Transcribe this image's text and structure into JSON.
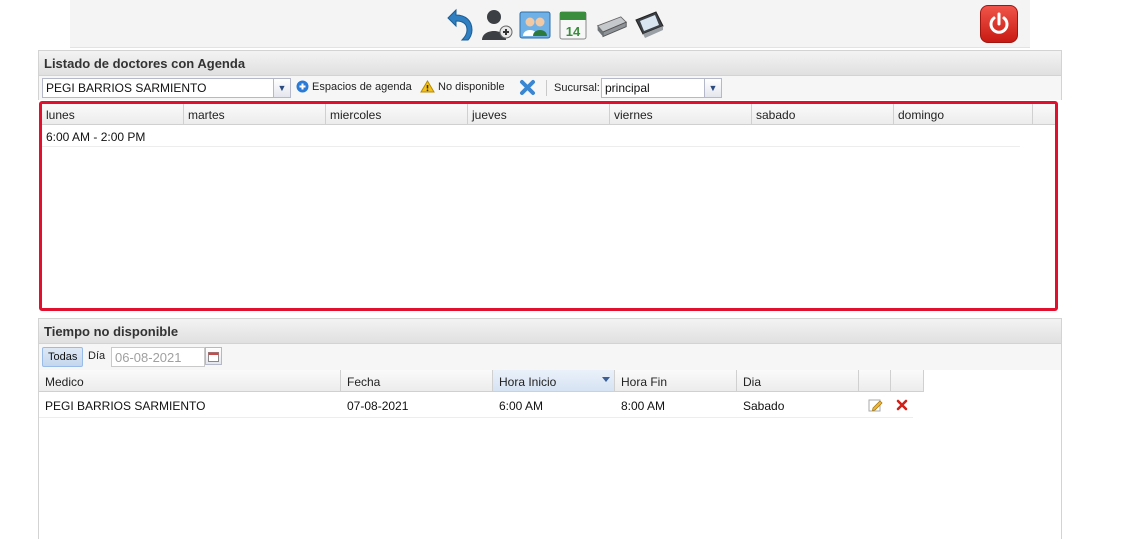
{
  "toolbar": {
    "icons": [
      "back-arrow-icon",
      "add-user-icon",
      "doctors-icon",
      "calendar-icon",
      "printer-icon",
      "monitor-icon"
    ],
    "calendar_day": "14",
    "power_icon": "power-icon"
  },
  "agenda_panel": {
    "title": "Listado de doctores con Agenda",
    "doctor_select": "PEGI BARRIOS SARMIENTO",
    "espacios_label": "Espacios de agenda",
    "no_disponible_label": "No disponible",
    "sucursal_label": "Sucursal:",
    "sucursal_value": "principal",
    "days": [
      "lunes",
      "martes",
      "miercoles",
      "jueves",
      "viernes",
      "sabado",
      "domingo"
    ],
    "schedule_row": "6:00 AM - 2:00 PM"
  },
  "unavailable_panel": {
    "title": "Tiempo no disponible",
    "todas_button": "Todas",
    "dia_label": "Día",
    "date_value": "06-08-2021",
    "columns": [
      "Medico",
      "Fecha",
      "Hora Inicio",
      "Hora Fin",
      "Dia"
    ],
    "rows": [
      {
        "medico": "PEGI BARRIOS SARMIENTO",
        "fecha": "07-08-2021",
        "hora_inicio": "6:00 AM",
        "hora_fin": "8:00 AM",
        "dia": "Sabado"
      }
    ]
  },
  "colors": {
    "highlight": "#e2102f",
    "power": "#d9261d",
    "accent": "#2b7bd6"
  }
}
